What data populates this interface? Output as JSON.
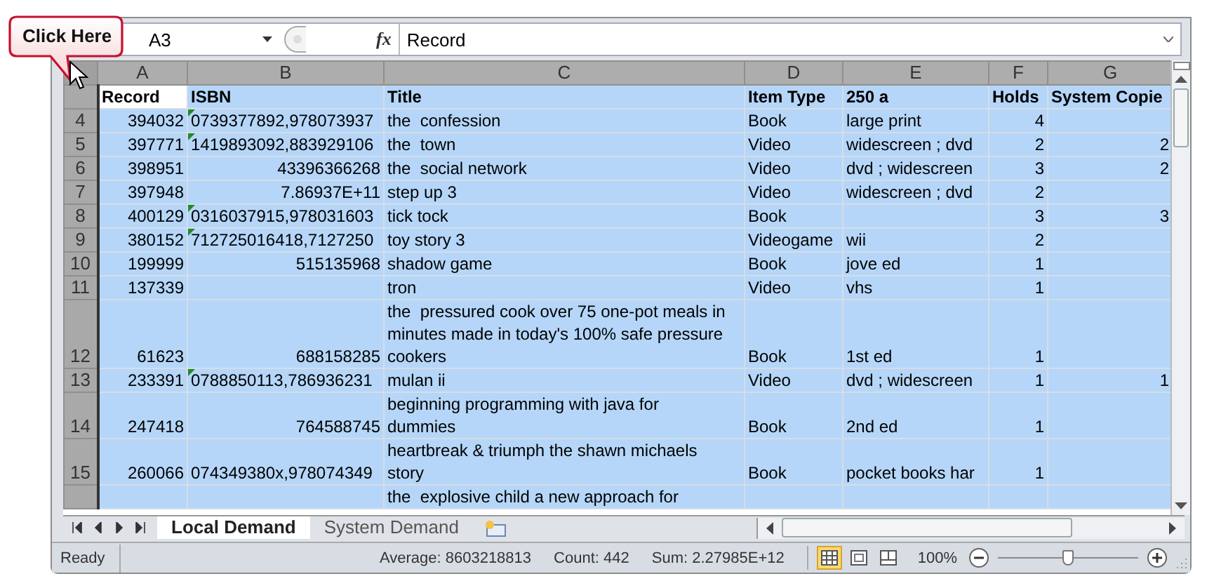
{
  "callout": {
    "text": "Click Here"
  },
  "formula_bar": {
    "name_box": "A3",
    "function_label": "fx",
    "formula": "Record"
  },
  "columns": [
    "A",
    "B",
    "C",
    "D",
    "E",
    "F",
    "G"
  ],
  "grid": {
    "selected": true,
    "rows": [
      {
        "header": true,
        "active_first_cell": true,
        "cells": [
          "Record",
          "ISBN",
          "Title",
          "Item Type",
          "250 a",
          "Holds",
          "System Copie"
        ]
      },
      {
        "number": "4",
        "flag": true,
        "isbn_text": true,
        "cells": [
          "394032",
          "0739377892,978073937",
          "the  confession",
          "Book",
          "large print",
          "4",
          null
        ]
      },
      {
        "number": "5",
        "flag": true,
        "isbn_text": true,
        "cells": [
          "397771",
          "1419893092,883929106",
          "the  town",
          "Video",
          "widescreen ; dvd",
          "2",
          "2"
        ]
      },
      {
        "number": "6",
        "flag": false,
        "isbn_text": false,
        "cells": [
          "398951",
          "43396366268",
          "the  social network",
          "Video",
          "dvd ; widescreen",
          "3",
          "2"
        ]
      },
      {
        "number": "7",
        "flag": false,
        "isbn_text": false,
        "cells": [
          "397948",
          "7.86937E+11",
          "step up 3",
          "Video",
          "widescreen ; dvd",
          "2",
          null
        ]
      },
      {
        "number": "8",
        "flag": true,
        "isbn_text": true,
        "cells": [
          "400129",
          "0316037915,978031603",
          "tick tock",
          "Book",
          null,
          "3",
          "3"
        ]
      },
      {
        "number": "9",
        "flag": true,
        "isbn_text": true,
        "cells": [
          "380152",
          "712725016418,7127250",
          "toy story 3",
          "Videogame",
          "wii",
          "2",
          null
        ]
      },
      {
        "number": "10",
        "flag": false,
        "isbn_text": false,
        "cells": [
          "199999",
          "515135968",
          "shadow game",
          "Book",
          "jove ed",
          "1",
          null
        ]
      },
      {
        "number": "11",
        "flag": false,
        "cells": [
          "137339",
          null,
          "tron",
          "Video",
          "vhs",
          "1",
          null
        ]
      },
      {
        "number": "12",
        "flag": false,
        "isbn_text": false,
        "cells": [
          "61623",
          "688158285",
          "the  pressured cook over 75 one-pot meals in minutes made in today's 100% safe pressure cookers",
          "Book",
          "1st ed",
          "1",
          null
        ]
      },
      {
        "number": "13",
        "flag": true,
        "isbn_text": true,
        "cells": [
          "233391",
          "0788850113,786936231",
          "mulan ii",
          "Video",
          "dvd ; widescreen",
          "1",
          "1"
        ]
      },
      {
        "number": "14",
        "flag": false,
        "isbn_text": false,
        "cells": [
          "247418",
          "764588745",
          "beginning programming with java for dummies",
          "Book",
          "2nd ed",
          "1",
          null
        ]
      },
      {
        "number": "15",
        "flag": false,
        "isbn_text": true,
        "cells": [
          "260066",
          "074349380x,978074349",
          "heartbreak & triumph the shawn michaels story",
          "Book",
          "pocket books har",
          "1",
          null
        ]
      },
      {
        "flag": false,
        "cells": [
          null,
          null,
          "the  explosive child a new approach for",
          null,
          null,
          null,
          null
        ]
      }
    ]
  },
  "sheet_tabs": [
    {
      "label": "Local Demand",
      "selected": true
    },
    {
      "label": "System Demand",
      "selected": false
    }
  ],
  "status_bar": {
    "mode": "Ready",
    "average": "Average: 8603218813",
    "count": "Count: 442",
    "sum": "Sum: 2.27985E+12",
    "views": [
      {
        "kind": "normal",
        "selected": true
      },
      {
        "kind": "page_layout",
        "selected": false
      },
      {
        "kind": "page_break",
        "selected": false
      }
    ],
    "zoom": "100%",
    "zoom_slider": {
      "level": 0.5
    }
  }
}
